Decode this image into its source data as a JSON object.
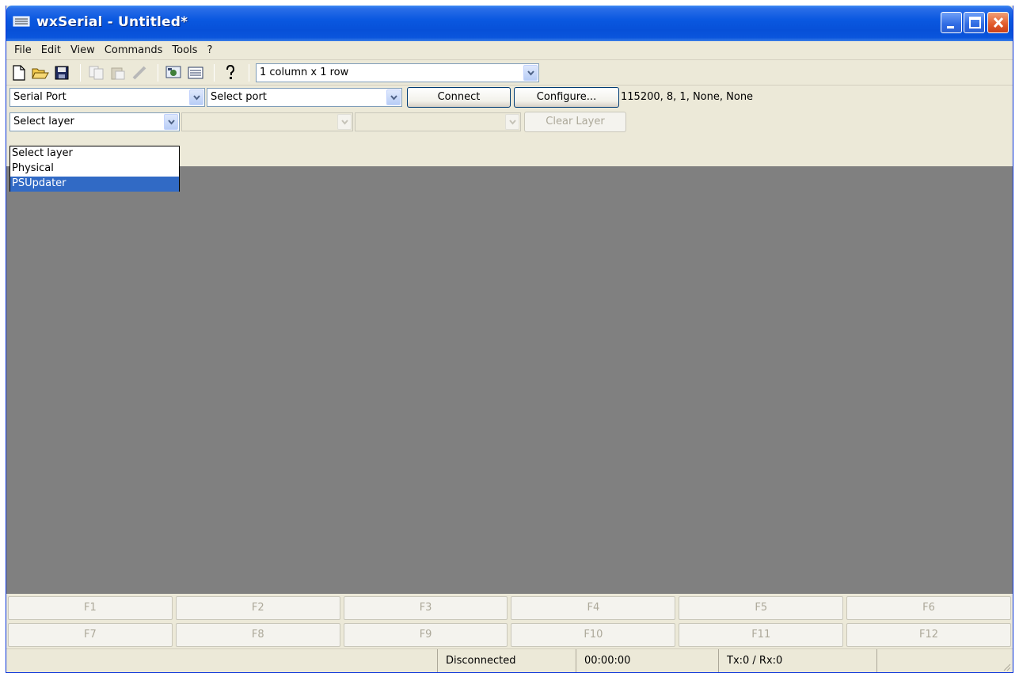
{
  "window": {
    "title": "wxSerial - Untitled*"
  },
  "menu": [
    "File",
    "Edit",
    "View",
    "Commands",
    "Tools",
    "?"
  ],
  "toolbar": {
    "icons": [
      "new-file-icon",
      "open-folder-icon",
      "save-icon",
      "copy-icon",
      "paste-icon",
      "clear-icon",
      "settings-icon",
      "window-icon",
      "help-icon"
    ],
    "layout_combo": "1 column x 1 row"
  },
  "serial": {
    "type_combo": "Serial Port",
    "port_combo": "Select port",
    "connect_label": "Connect",
    "configure_label": "Configure...",
    "port_settings": "115200, 8, 1, None, None"
  },
  "layer": {
    "layer_combo": "Select layer",
    "clear_label": "Clear Layer",
    "options": [
      "Select layer",
      "Physical",
      "PSUpdater"
    ],
    "highlighted_option": "PSUpdater"
  },
  "fkeys": {
    "row1": [
      "F1",
      "F2",
      "F3",
      "F4",
      "F5",
      "F6"
    ],
    "row2": [
      "F7",
      "F8",
      "F9",
      "F10",
      "F11",
      "F12"
    ]
  },
  "status": {
    "cell1": "",
    "connection": "Disconnected",
    "elapsed": "00:00:00",
    "traffic": "Tx:0 / Rx:0"
  },
  "colors": {
    "terminal_bg": "#808080",
    "selection": "#316ac5",
    "window_face": "#ece9d8"
  }
}
